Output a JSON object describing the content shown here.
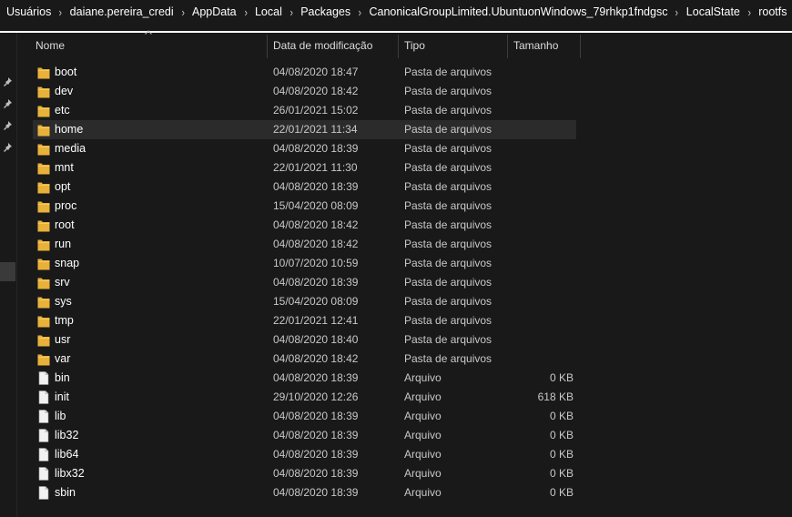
{
  "breadcrumb": [
    "Usuários",
    "daiane.pereira_credi",
    "AppData",
    "Local",
    "Packages",
    "CanonicalGroupLimited.UbuntuonWindows_79rhkp1fndgsc",
    "LocalState",
    "rootfs"
  ],
  "columns": {
    "name": "Nome",
    "date": "Data de modificação",
    "type": "Tipo",
    "size": "Tamanho"
  },
  "colors": {
    "folder": "#e8b13a",
    "file": "#f2f2f2",
    "accent_line": "#ffffff"
  },
  "rows": [
    {
      "name": "boot",
      "date": "04/08/2020 18:47",
      "type": "Pasta de arquivos",
      "size": "",
      "icon": "folder-icon"
    },
    {
      "name": "dev",
      "date": "04/08/2020 18:42",
      "type": "Pasta de arquivos",
      "size": "",
      "icon": "folder-icon"
    },
    {
      "name": "etc",
      "date": "26/01/2021 15:02",
      "type": "Pasta de arquivos",
      "size": "",
      "icon": "folder-icon"
    },
    {
      "name": "home",
      "date": "22/01/2021 11:34",
      "type": "Pasta de arquivos",
      "size": "",
      "icon": "folder-icon",
      "hover": true
    },
    {
      "name": "media",
      "date": "04/08/2020 18:39",
      "type": "Pasta de arquivos",
      "size": "",
      "icon": "folder-icon"
    },
    {
      "name": "mnt",
      "date": "22/01/2021 11:30",
      "type": "Pasta de arquivos",
      "size": "",
      "icon": "folder-icon"
    },
    {
      "name": "opt",
      "date": "04/08/2020 18:39",
      "type": "Pasta de arquivos",
      "size": "",
      "icon": "folder-icon"
    },
    {
      "name": "proc",
      "date": "15/04/2020 08:09",
      "type": "Pasta de arquivos",
      "size": "",
      "icon": "folder-icon"
    },
    {
      "name": "root",
      "date": "04/08/2020 18:42",
      "type": "Pasta de arquivos",
      "size": "",
      "icon": "folder-icon"
    },
    {
      "name": "run",
      "date": "04/08/2020 18:42",
      "type": "Pasta de arquivos",
      "size": "",
      "icon": "folder-icon"
    },
    {
      "name": "snap",
      "date": "10/07/2020 10:59",
      "type": "Pasta de arquivos",
      "size": "",
      "icon": "folder-icon"
    },
    {
      "name": "srv",
      "date": "04/08/2020 18:39",
      "type": "Pasta de arquivos",
      "size": "",
      "icon": "folder-icon"
    },
    {
      "name": "sys",
      "date": "15/04/2020 08:09",
      "type": "Pasta de arquivos",
      "size": "",
      "icon": "folder-icon"
    },
    {
      "name": "tmp",
      "date": "22/01/2021 12:41",
      "type": "Pasta de arquivos",
      "size": "",
      "icon": "folder-icon"
    },
    {
      "name": "usr",
      "date": "04/08/2020 18:40",
      "type": "Pasta de arquivos",
      "size": "",
      "icon": "folder-icon"
    },
    {
      "name": "var",
      "date": "04/08/2020 18:42",
      "type": "Pasta de arquivos",
      "size": "",
      "icon": "folder-icon"
    },
    {
      "name": "bin",
      "date": "04/08/2020 18:39",
      "type": "Arquivo",
      "size": "0 KB",
      "icon": "file-icon"
    },
    {
      "name": "init",
      "date": "29/10/2020 12:26",
      "type": "Arquivo",
      "size": "618 KB",
      "icon": "file-icon"
    },
    {
      "name": "lib",
      "date": "04/08/2020 18:39",
      "type": "Arquivo",
      "size": "0 KB",
      "icon": "file-icon"
    },
    {
      "name": "lib32",
      "date": "04/08/2020 18:39",
      "type": "Arquivo",
      "size": "0 KB",
      "icon": "file-icon"
    },
    {
      "name": "lib64",
      "date": "04/08/2020 18:39",
      "type": "Arquivo",
      "size": "0 KB",
      "icon": "file-icon"
    },
    {
      "name": "libx32",
      "date": "04/08/2020 18:39",
      "type": "Arquivo",
      "size": "0 KB",
      "icon": "file-icon"
    },
    {
      "name": "sbin",
      "date": "04/08/2020 18:39",
      "type": "Arquivo",
      "size": "0 KB",
      "icon": "file-icon"
    }
  ]
}
